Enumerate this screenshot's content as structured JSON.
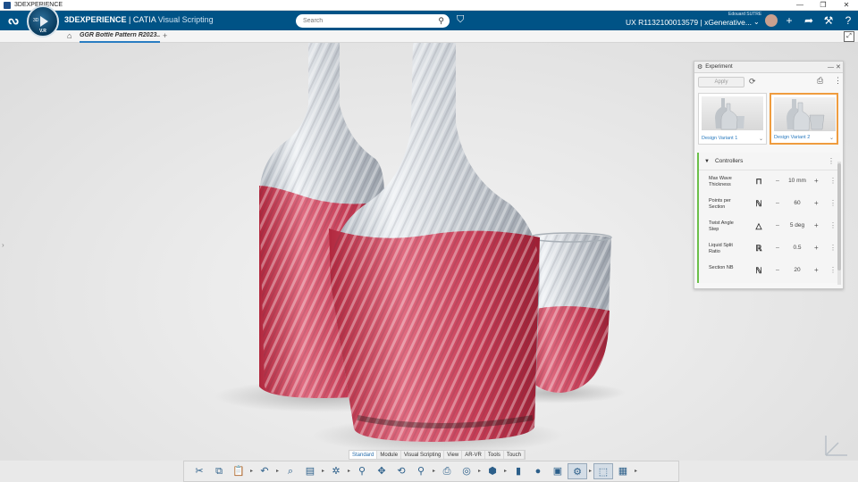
{
  "window": {
    "title": "3DEXPERIENCE",
    "controls": [
      "—",
      "❐",
      "✕"
    ]
  },
  "topbar": {
    "brand_bold": "3DEXPERIENCE",
    "brand_mid": " | CATIA ",
    "brand_app": "Visual Scripting",
    "search_placeholder": "Search",
    "user_name": "Edouard SUTRE",
    "context": "UX R1132100013579 | xGenerative...",
    "colors": {
      "bar": "#005386"
    }
  },
  "compass": {
    "label_3d": "3D",
    "version": "V.R"
  },
  "tabs": {
    "active": "GGR Bottle Pattern R2023...",
    "add": "+"
  },
  "panel": {
    "title": "Experiment",
    "apply_label": "Apply",
    "variants": [
      {
        "label": "Design Variant 1",
        "active": false
      },
      {
        "label": "Design Variant 2",
        "active": true
      }
    ],
    "section_title": "Controllers",
    "controllers": [
      {
        "label": "Max Wave Thickness",
        "icon": "thickness-icon",
        "value": "10 mm"
      },
      {
        "label": "Points per Section",
        "icon": "integer-icon",
        "value": "60"
      },
      {
        "label": "Twist Angle Step",
        "icon": "angle-icon",
        "value": "5 deg"
      },
      {
        "label": "Liquid Split Ratio",
        "icon": "real-icon",
        "value": "0.5"
      },
      {
        "label": "Section NB",
        "icon": "integer-icon",
        "value": "20"
      }
    ],
    "colors": {
      "accent_active": "#ef9c3f",
      "section_bar": "#6cc04a"
    }
  },
  "section_tabs": [
    "Standard",
    "Module",
    "Visual Scripting",
    "View",
    "AR-VR",
    "Tools",
    "Touch"
  ],
  "section_tab_active": "Standard"
}
